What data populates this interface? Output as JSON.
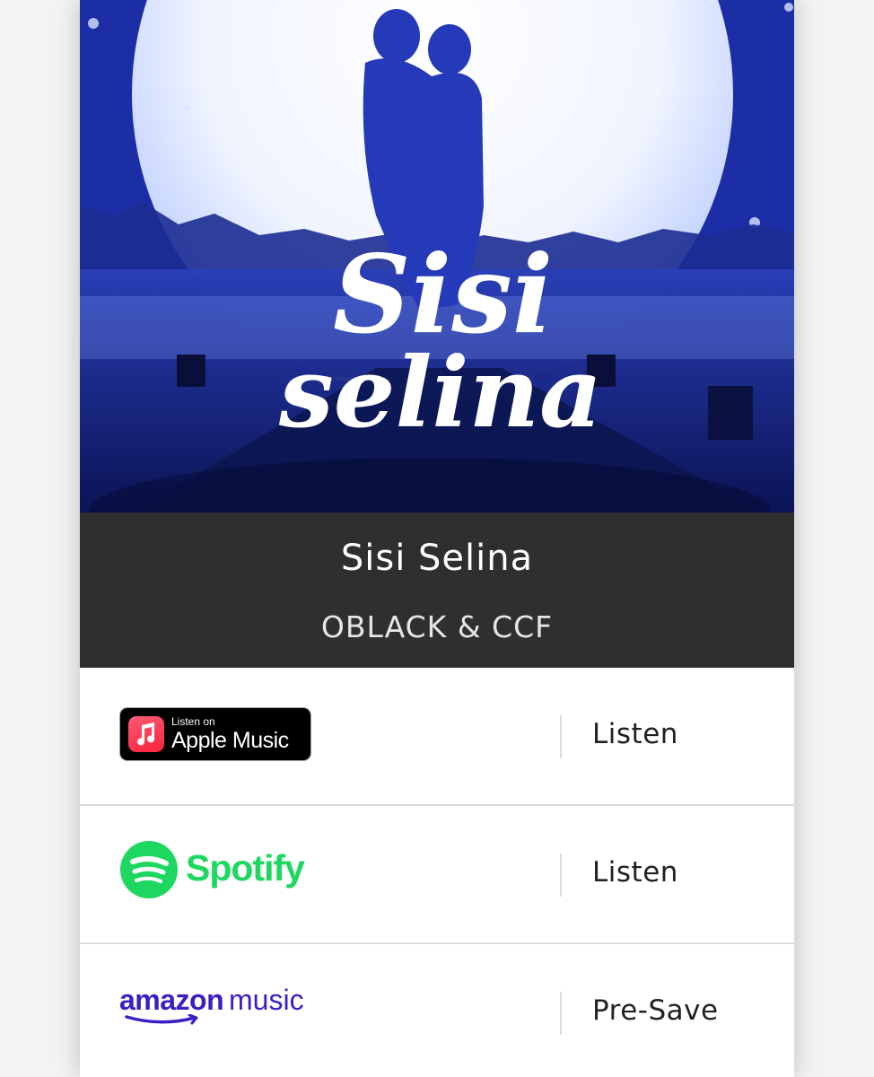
{
  "release": {
    "cover_title_line1": "Sisi",
    "cover_title_line2": "selina",
    "title": "Sisi Selina",
    "artist": "OBLACK & CCF"
  },
  "services": [
    {
      "id": "apple-music",
      "logo_icon": "apple-music-note-icon",
      "badge_small": "Listen on",
      "badge_big": "Apple Music",
      "action": "Listen"
    },
    {
      "id": "spotify",
      "logo_icon": "spotify-icon",
      "brand": "Spotify",
      "action": "Listen"
    },
    {
      "id": "amazon-music",
      "logo_icon": "amazon-smile-icon",
      "brand_part1": "amazon",
      "brand_part2": "music",
      "action": "Pre-Save"
    }
  ],
  "colors": {
    "info_bg": "#2f2f2f",
    "spotify_green": "#1ed760",
    "amazon_purple": "#3a1fc4",
    "apple_red": "#fa233b",
    "cover_blue": "#1a2fa8"
  }
}
